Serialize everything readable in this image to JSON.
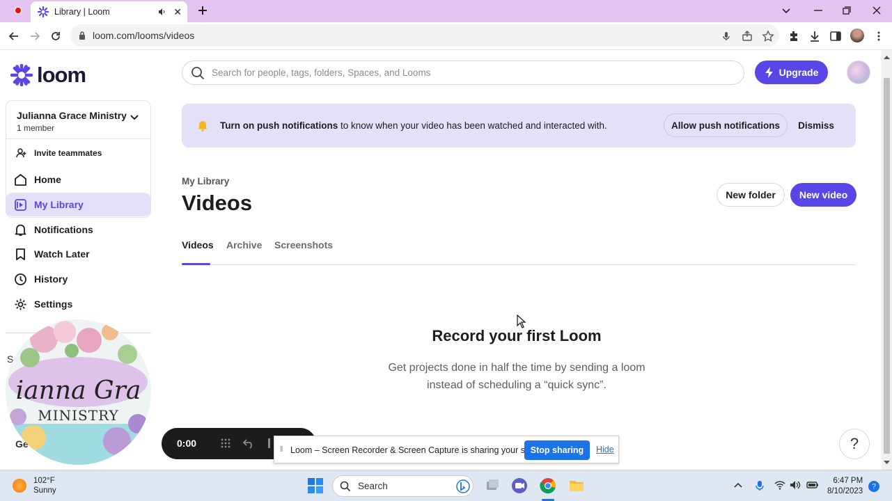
{
  "browser": {
    "tab_title": "Library | Loom",
    "url": "loom.com/looms/videos"
  },
  "sidebar": {
    "logo_text": "loom",
    "workspace_name": "Julianna Grace Ministry",
    "workspace_members": "1 member",
    "invite_label": "Invite teammates",
    "nav": [
      {
        "label": "Home",
        "icon": "home-icon"
      },
      {
        "label": "My Library",
        "icon": "library-icon"
      },
      {
        "label": "Notifications",
        "icon": "bell-icon"
      },
      {
        "label": "Watch Later",
        "icon": "bookmark-icon"
      },
      {
        "label": "History",
        "icon": "clock-icon"
      },
      {
        "label": "Settings",
        "icon": "gear-icon"
      }
    ],
    "active_item": "My Library",
    "partial_label_s": "S",
    "partial_label_ge": "Ge",
    "badge_line1": "ianna Gra",
    "badge_line2": "MINISTRY"
  },
  "header": {
    "search_placeholder": "Search for people, tags, folders, Spaces, and Looms",
    "upgrade_label": "Upgrade"
  },
  "banner": {
    "bold_text": "Turn on push notifications",
    "rest_text": " to know when your video has been watched and interacted with.",
    "allow_label": "Allow push notifications",
    "dismiss_label": "Dismiss"
  },
  "library": {
    "breadcrumb": "My Library",
    "title": "Videos",
    "new_folder_label": "New folder",
    "new_video_label": "New video",
    "tabs": [
      "Videos",
      "Archive",
      "Screenshots"
    ],
    "active_tab": "Videos",
    "empty_title": "Record your first Loom",
    "empty_line1": "Get projects done in half the time by sending a loom",
    "empty_line2": "instead of scheduling a “quick sync”."
  },
  "recorder": {
    "time": "0:00"
  },
  "share_bar": {
    "message": "Loom – Screen Recorder & Screen Capture is sharing your screen.",
    "stop_label": "Stop sharing",
    "hide_label": "Hide"
  },
  "help_label": "?",
  "taskbar": {
    "temperature": "102°F",
    "condition": "Sunny",
    "search_label": "Search",
    "time": "6:47 PM",
    "date": "8/10/2023"
  },
  "colors": {
    "accent": "#5a46e6",
    "banner_bg": "#e4e0f8",
    "tab_bar": "#e3c3ef"
  }
}
